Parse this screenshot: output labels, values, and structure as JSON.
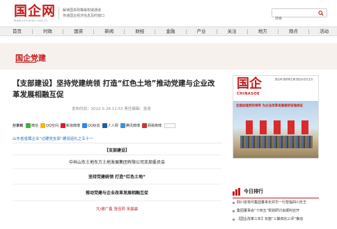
{
  "header": {
    "logo": "国企网",
    "logo_sub": "www.chinasoe.com.cn",
    "tagline_1": "解读国资政策最权威通道",
    "tagline_2": "传递国企经济信息及时窗口",
    "search_placeholder": "搜索"
  },
  "nav": {
    "items": [
      "首页",
      "时政",
      "国资",
      "新闻",
      "财经",
      "金融",
      "产业",
      "关注",
      "地方",
      "观点",
      "活动"
    ]
  },
  "section": {
    "title": "国企党建"
  },
  "article": {
    "title": "【支部建设】坚持党建统领 打造“红色土地”推动党建与企业改革发展相融互促",
    "meta": "发布时间：2022-5-26 11:53  责任编辑：张尧",
    "share_label": "分享到",
    "share": [
      {
        "label": "微信",
        "color": "#3db13d"
      },
      {
        "label": "QQ空间",
        "color": "#f5b700"
      },
      {
        "label": "新浪微博",
        "color": "#e6162d"
      },
      {
        "label": "QQ好友",
        "color": "#2a8ae6"
      },
      {
        "label": "人人网",
        "color": "#1d5fa8"
      },
      {
        "label": "腾讯微博",
        "color": "#3b92d8"
      },
      {
        "label": "网易微博",
        "color": "#d0312d"
      }
    ],
    "lead": "山东省省属企业“过硬党支部”建设巡礼之五十一",
    "lines": [
      "【支部建设】",
      "中共山东土地东方土地发展集团有限公司支部委员会",
      "坚持党建统领  打造“红色土地”",
      "推动党建与企业改革发展相融互促",
      "文/谢广鑫  张佳莉  宋晨晨"
    ]
  },
  "cover": {
    "logo": "国企",
    "logo_en": "CHINASOE",
    "side_text": "国企网 国资委主管 国企杂志社主办",
    "headline": "全面加强党的领导 为企业改革发展提供坚强保证"
  },
  "rank": {
    "title": "今日排行",
    "items": [
      "四川省将尽集团董事长邓华一行莅临四川天王",
      "集团董事会“十四五”规划研讨会顺利召开",
      "【国企改革三年】实施“三聚四化三评”推动"
    ]
  }
}
